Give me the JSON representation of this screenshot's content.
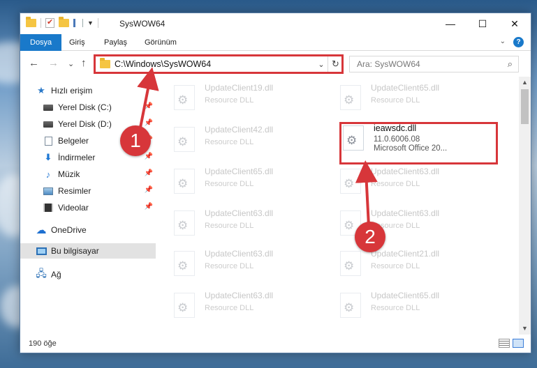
{
  "window": {
    "title": "SysWOW64",
    "controls": {
      "minimize": "—",
      "maximize": "☐",
      "close": "✕"
    }
  },
  "ribbon": {
    "tabs": [
      {
        "label": "Dosya",
        "active": true
      },
      {
        "label": "Giriş",
        "active": false
      },
      {
        "label": "Paylaş",
        "active": false
      },
      {
        "label": "Görünüm",
        "active": false
      }
    ],
    "help": "?",
    "collapse": "⌄"
  },
  "nav": {
    "back": "←",
    "forward": "→",
    "recent": "⌄",
    "up": "↑",
    "address": "C:\\Windows\\SysWOW64",
    "address_dropdown": "⌄",
    "refresh": "↻",
    "search_placeholder": "Ara: SysWOW64",
    "search_icon": "⌕"
  },
  "sidebar": {
    "items": [
      {
        "label": "Hızlı erişim",
        "icon": "star-icon",
        "pinned": false
      },
      {
        "label": "Yerel Disk (C:)",
        "icon": "disk-icon",
        "pinned": true
      },
      {
        "label": "Yerel Disk (D:)",
        "icon": "disk-icon",
        "pinned": true
      },
      {
        "label": "Belgeler",
        "icon": "document-icon",
        "pinned": true
      },
      {
        "label": "İndirmeler",
        "icon": "download-icon",
        "pinned": true
      },
      {
        "label": "Müzik",
        "icon": "music-icon",
        "pinned": true
      },
      {
        "label": "Resimler",
        "icon": "pictures-icon",
        "pinned": true
      },
      {
        "label": "Videolar",
        "icon": "video-icon",
        "pinned": true
      },
      {
        "label": "OneDrive",
        "icon": "cloud-icon",
        "pinned": false
      },
      {
        "label": "Bu bilgisayar",
        "icon": "computer-icon",
        "pinned": false,
        "selected": true
      },
      {
        "label": "Ağ",
        "icon": "network-icon",
        "pinned": false
      }
    ],
    "pin_glyph": "📌"
  },
  "files": {
    "left": [
      {
        "name": "UpdateClient19.dll",
        "desc": "Resource DLL"
      },
      {
        "name": "UpdateClient42.dll",
        "desc": "Resource DLL"
      },
      {
        "name": "UpdateClient65.dll",
        "desc": "Resource DLL"
      },
      {
        "name": "UpdateClient63.dll",
        "desc": "Resource DLL"
      },
      {
        "name": "UpdateClient63.dll",
        "desc": "Resource DLL"
      },
      {
        "name": "UpdateClient63.dll",
        "desc": "Resource DLL"
      }
    ],
    "right": [
      {
        "name": "UpdateClient65.dll",
        "desc": "Resource DLL"
      },
      {
        "name": "ieawsdc.dll",
        "version": "11.0.6006.08",
        "desc": "Microsoft Office 20...",
        "highlighted": true
      },
      {
        "name": "UpdateClient63.dll",
        "desc": "Resource DLL"
      },
      {
        "name": "UpdateClient63.dll",
        "desc": "Resource DLL"
      },
      {
        "name": "UpdateClient21.dll",
        "desc": "Resource DLL"
      },
      {
        "name": "UpdateClient65.dll",
        "desc": "Resource DLL"
      }
    ]
  },
  "status": {
    "count": "190 öğe"
  },
  "annotations": {
    "step1": "1",
    "step2": "2",
    "color": "#d7363a"
  }
}
